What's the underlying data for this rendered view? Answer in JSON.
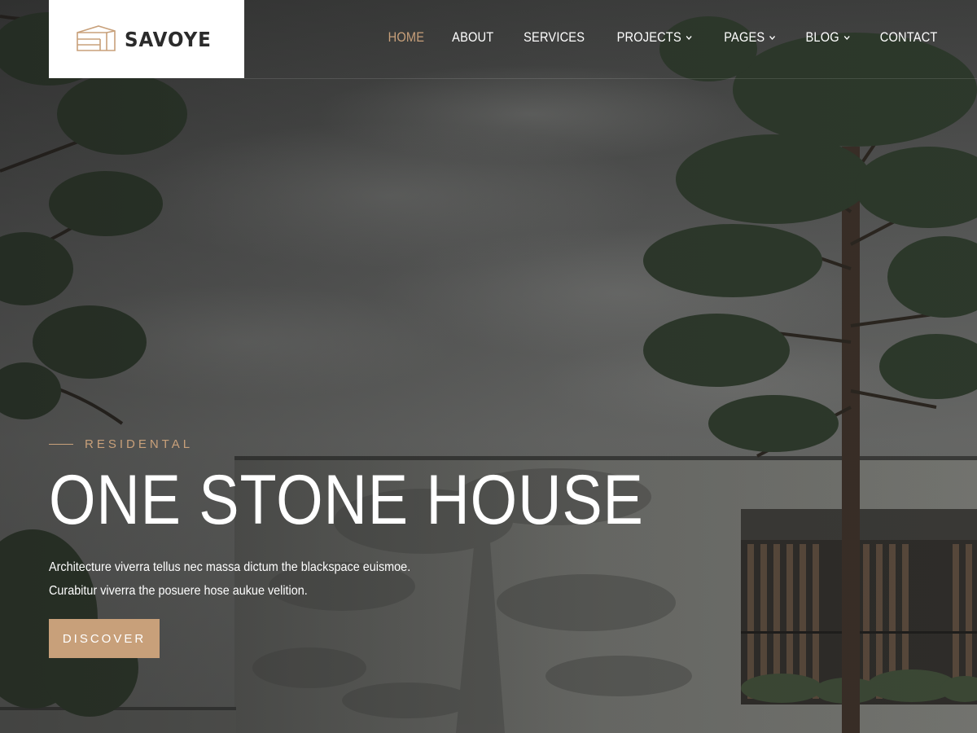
{
  "brand": {
    "name": "SAVOYE",
    "logo_icon": "stacked-building-icon"
  },
  "nav": {
    "items": [
      {
        "label": "HOME",
        "active": true,
        "dropdown": false
      },
      {
        "label": "ABOUT",
        "active": false,
        "dropdown": false
      },
      {
        "label": "SERVICES",
        "active": false,
        "dropdown": false
      },
      {
        "label": "PROJECTS",
        "active": false,
        "dropdown": true
      },
      {
        "label": "PAGES",
        "active": false,
        "dropdown": true
      },
      {
        "label": "BLOG",
        "active": false,
        "dropdown": true
      },
      {
        "label": "CONTACT",
        "active": false,
        "dropdown": false
      }
    ]
  },
  "hero": {
    "eyebrow": "RESIDENTAL",
    "title": "ONE STONE HOUSE",
    "description_line1": "Architecture viverra tellus nec massa dictum the blackspace euismoe.",
    "description_line2": "Curabitur viverra the posuere hose aukue velition.",
    "button_label": "DISCOVER"
  },
  "colors": {
    "accent": "#c8a07a",
    "text_light": "#ffffff",
    "logo_bg": "#ffffff",
    "logo_text": "#2b2b2b"
  }
}
